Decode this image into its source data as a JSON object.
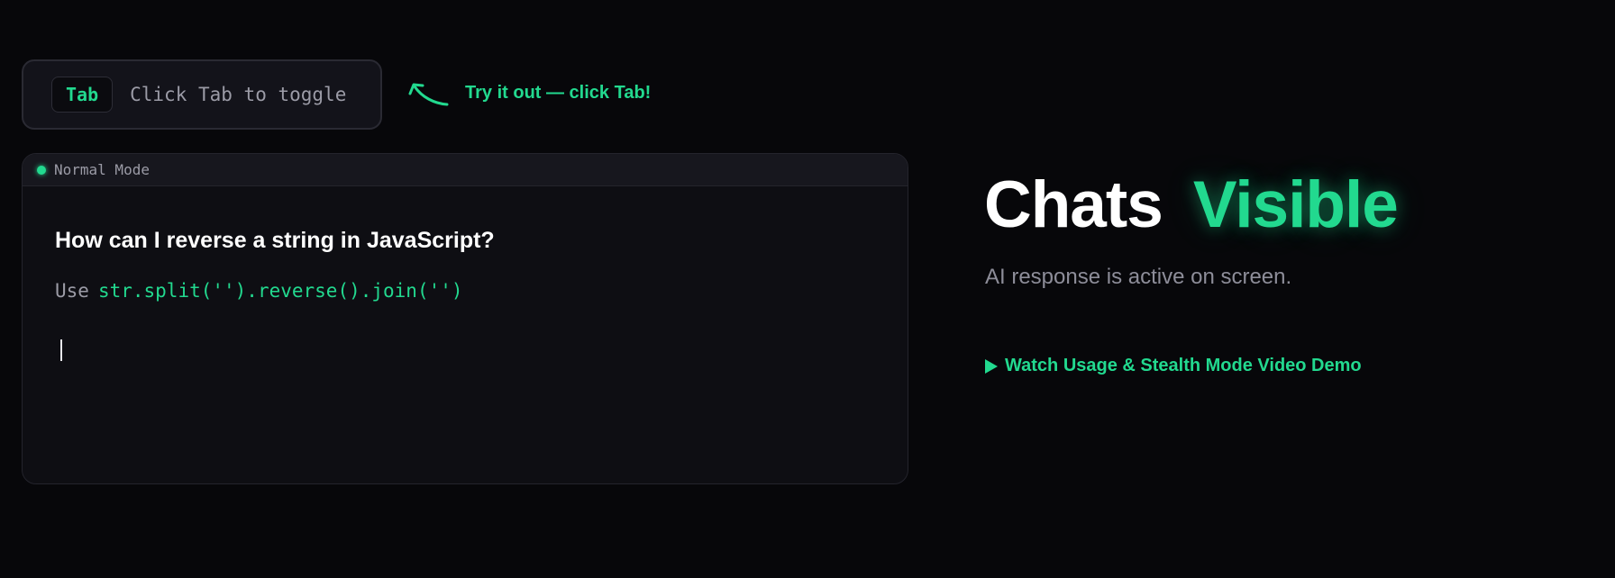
{
  "toggle": {
    "key_label": "Tab",
    "hint": "Click Tab to toggle"
  },
  "callout": {
    "text": "Try it out — click Tab!",
    "icon": "curved-arrow-icon"
  },
  "chat_panel": {
    "mode_label": "Normal Mode",
    "question": "How can I reverse a string in JavaScript?",
    "answer_prefix": "Use",
    "answer_code": "str.split('').reverse().join('')"
  },
  "hero": {
    "title_main": "Chats",
    "title_accent": "Visible",
    "subtitle": "AI response is active on screen.",
    "demo_link": "Watch Usage & Stealth Mode Video Demo",
    "demo_icon": "play-icon"
  },
  "colors": {
    "accent": "#22d98f",
    "background": "#07070a",
    "panel": "#0e0e13"
  }
}
